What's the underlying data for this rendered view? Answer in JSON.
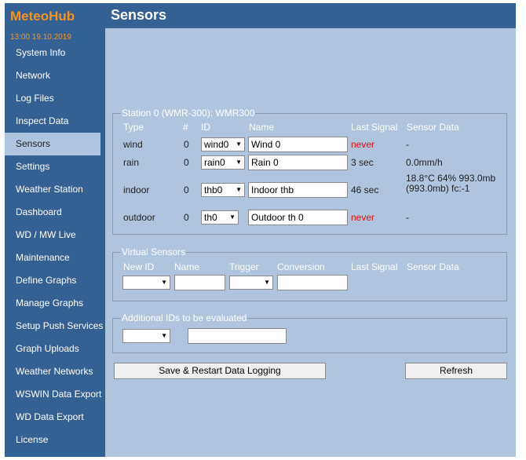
{
  "app": {
    "logo": "MeteoHub",
    "datetime": "13:00  19.10.2019"
  },
  "header": {
    "title": "Sensors"
  },
  "sidebar": {
    "items": [
      {
        "label": "System Info"
      },
      {
        "label": "Network"
      },
      {
        "label": "Log Files"
      },
      {
        "label": "Inspect Data"
      },
      {
        "label": "Sensors"
      },
      {
        "label": "Settings"
      },
      {
        "label": "Weather Station"
      },
      {
        "label": "Dashboard"
      },
      {
        "label": "WD / MW Live"
      },
      {
        "label": "Maintenance"
      },
      {
        "label": "Define Graphs"
      },
      {
        "label": "Manage Graphs"
      },
      {
        "label": "Setup Push Services"
      },
      {
        "label": "Graph Uploads"
      },
      {
        "label": "Weather Networks"
      },
      {
        "label": "WSWIN Data Export"
      },
      {
        "label": "WD Data Export"
      },
      {
        "label": "License"
      }
    ],
    "active": "Sensors"
  },
  "station": {
    "legend": "Station 0 (WMR-300): WMR300",
    "columns": {
      "type": "Type",
      "num": "#",
      "id": "ID",
      "name": "Name",
      "last_signal": "Last Signal",
      "sensor_data": "Sensor Data"
    },
    "rows": [
      {
        "type": "wind",
        "num": "0",
        "id": "wind0",
        "name": "Wind 0",
        "last_signal": "never",
        "sensor_data": "-"
      },
      {
        "type": "rain",
        "num": "0",
        "id": "rain0",
        "name": "Rain 0",
        "last_signal": "3 sec",
        "sensor_data": "0.0mm/h"
      },
      {
        "type": "indoor",
        "num": "0",
        "id": "thb0",
        "name": "Indoor thb",
        "last_signal": "46 sec",
        "sensor_data": "18.8°C 64% 993.0mb (993.0mb) fc:-1"
      },
      {
        "type": "outdoor",
        "num": "0",
        "id": "th0",
        "name": "Outdoor th 0",
        "last_signal": "never",
        "sensor_data": "-"
      }
    ]
  },
  "virtual": {
    "legend": "Virtual Sensors",
    "columns": {
      "new_id": "New ID",
      "name": "Name",
      "trigger": "Trigger",
      "conversion": "Conversion",
      "last_signal": "Last Signal",
      "sensor_data": "Sensor Data"
    },
    "new_id_value": "",
    "name_value": "",
    "trigger_value": "",
    "conversion_value": ""
  },
  "additional": {
    "legend": "Additional IDs to be evaluated",
    "select_value": "",
    "input_value": ""
  },
  "buttons": {
    "save": "Save & Restart Data Logging",
    "refresh": "Refresh"
  },
  "colors": {
    "nav_bg": "#346193",
    "content_bg": "#b0c4de",
    "logo": "#f7941d",
    "never": "#e01010"
  }
}
